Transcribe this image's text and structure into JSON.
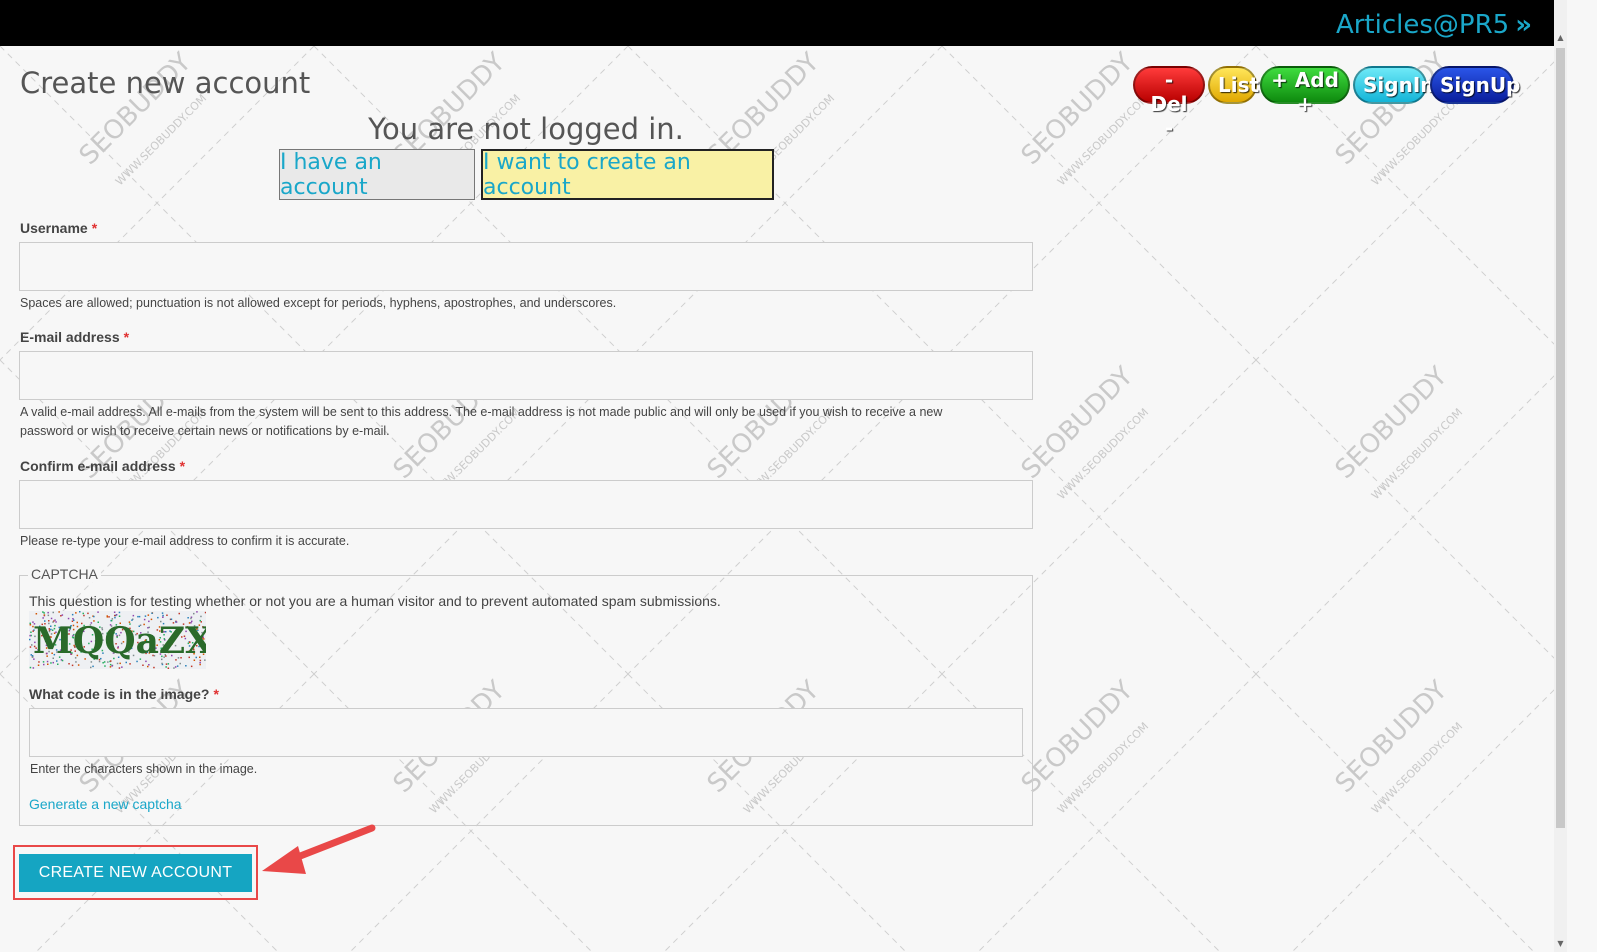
{
  "header": {
    "brand_label": "Articles@PR5",
    "brand_suffix": "»"
  },
  "page": {
    "title": "Create new account",
    "status_text": "You are not logged in."
  },
  "account_tabs": {
    "have_account": "I have an account",
    "create_account": "I want to create an account"
  },
  "action_pills": [
    {
      "label": "- Del -",
      "color": "#d90000"
    },
    {
      "label": "List",
      "color": "#f2c400"
    },
    {
      "label": "+ Add +",
      "color": "#1aae1a"
    },
    {
      "label": "SignIn",
      "color": "#2ccbe6"
    },
    {
      "label": "SignUp",
      "color": "#1a2fcc"
    }
  ],
  "form": {
    "username": {
      "label": "Username",
      "required_mark": "*",
      "value": "",
      "help": "Spaces are allowed; punctuation is not allowed except for periods, hyphens, apostrophes, and underscores."
    },
    "email": {
      "label": "E-mail address",
      "required_mark": "*",
      "value": "",
      "help_line1": "A valid e-mail address. All e-mails from the system will be sent to this address. The e-mail address is not made public and will only be used if you wish to receive a new",
      "help_line2": "password or wish to receive certain news or notifications by e-mail."
    },
    "confirm_email": {
      "label": "Confirm e-mail address",
      "required_mark": "*",
      "value": "",
      "help": "Please re-type your e-mail address to confirm it is accurate."
    },
    "captcha": {
      "legend": "CAPTCHA",
      "description": "This question is for testing whether or not you are a human visitor and to prevent automated spam submissions.",
      "image_text": "MQQaZX",
      "code_label": "What code is in the image?",
      "required_mark": "*",
      "value": "",
      "help": "Enter the characters shown in the image.",
      "regenerate_link": "Generate a new captcha"
    },
    "submit_label": "CREATE NEW ACCOUNT"
  },
  "watermark": {
    "brand": "SEOBUDDY",
    "domain": "WWW.SEOBUDDY.COM"
  },
  "colors": {
    "accent": "#1aa7c9",
    "submit_bg": "#15a5c2",
    "highlight_tab": "#f9f1a5",
    "annotation_red": "#e94848",
    "required": "#e03131"
  }
}
